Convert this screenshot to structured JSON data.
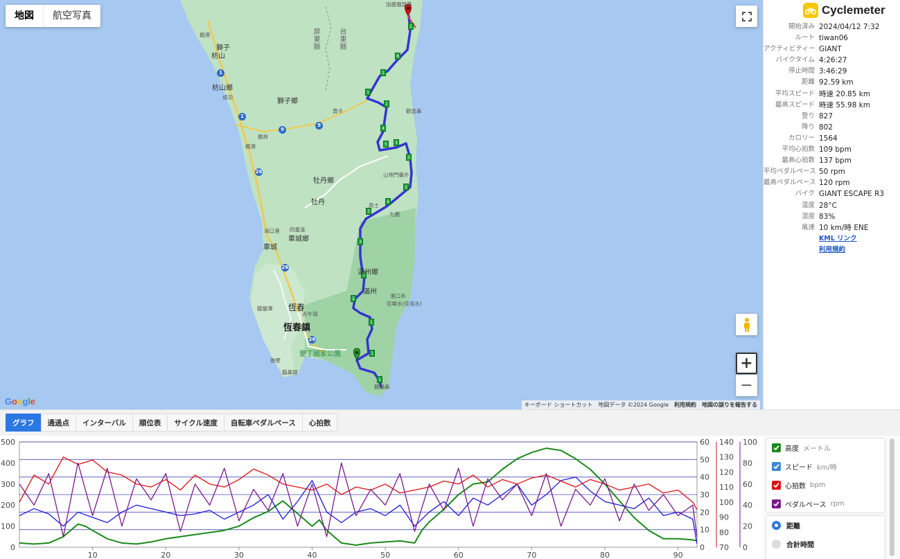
{
  "map_toggle": {
    "map": "地図",
    "satellite": "航空写真"
  },
  "map_labels": {
    "top": "加鹿俄部落",
    "county_pingtung": "屏東縣",
    "county_taitung": "台東縣",
    "fengang": "楓港",
    "shizi": "獅子",
    "fangshan": "枋山",
    "fangshan_xiang": "枋山鄉",
    "chenggong": "成功",
    "shizi_xiang": "獅子鄉",
    "shoka": "壽卡",
    "guanyinbi": "觀音鼻",
    "fengang2": "楓林",
    "fenggang3": "楓港",
    "mudan_xiang": "牡丹鄉",
    "mudan": "牡丹",
    "xuhai": "山地門番外",
    "gaoshi": "高士",
    "jiupeng": "九棚",
    "sichongxi": "四重溪",
    "checheng_xiang": "車城鄉",
    "haikou": "海口港",
    "checheng": "車城",
    "manzhou_xiang": "滿州鄉",
    "manzhou": "滿州",
    "gangkou": "港口吊",
    "jialeshui": "佳樂水(佳洛水)",
    "hengchun": "恆春",
    "hengchun_zhen": "恆春鎮",
    "longluan": "龍鑾潭",
    "dazhou": "赤牛嶺",
    "kenting": "墾丁國家公園",
    "eluanbi": "鵝鑾鼻",
    "houbi": "後壁",
    "maobitou": "貓鼻頭",
    "shanhai": "社頂"
  },
  "map_attribution": {
    "shortcuts": "キーボード ショートカット",
    "data": "地図データ ©2024 Google",
    "terms": "利用規約",
    "report": "地図の誤りを報告する"
  },
  "google_logo": "Google",
  "brand": {
    "name": "Cyclemeter"
  },
  "info": [
    {
      "k": "開始済み",
      "v": "2024/04/12 7:32"
    },
    {
      "k": "ルート",
      "v": "tiwan06"
    },
    {
      "k": "アクティビティー",
      "v": "GIANT"
    },
    {
      "k": "バイクタイム",
      "v": "4:26:27"
    },
    {
      "k": "停止時間",
      "v": "3:46:29"
    },
    {
      "k": "距離",
      "v": "92.59 km"
    },
    {
      "k": "平均スピード",
      "v": "時速 20.85 km"
    },
    {
      "k": "最高スピード",
      "v": "時速 55.98 km"
    },
    {
      "k": "登り",
      "v": "827"
    },
    {
      "k": "降り",
      "v": "802"
    },
    {
      "k": "カロリー",
      "v": "1564"
    },
    {
      "k": "平均心拍数",
      "v": "109 bpm"
    },
    {
      "k": "最高心拍数",
      "v": "137 bpm"
    },
    {
      "k": "平均ペダルペース",
      "v": "50 rpm"
    },
    {
      "k": "最高ペダルペース",
      "v": "120 rpm"
    },
    {
      "k": "バイク",
      "v": "GIANT ESCAPE R3"
    },
    {
      "k": "温度",
      "v": "28°C"
    },
    {
      "k": "湿度",
      "v": "83%"
    },
    {
      "k": "風速",
      "v": "10 km/時 ENE"
    }
  ],
  "links": {
    "kml": "KML リンク",
    "terms": "利用規約"
  },
  "tabs": [
    "グラフ",
    "通過点",
    "インターバル",
    "順位表",
    "サイクル速度",
    "自転車ペダルペース",
    "心拍数"
  ],
  "legend": [
    {
      "name": "高度",
      "unit": "メートル",
      "color": "#1a8a1a"
    },
    {
      "name": "スピード",
      "unit": "km/時",
      "color": "#3a8ad8"
    },
    {
      "name": "心拍数",
      "unit": "bpm",
      "color": "#e01010"
    },
    {
      "name": "ペダルペース",
      "unit": "rpm",
      "color": "#7a1a8a"
    }
  ],
  "x_axis_options": {
    "distance": "距離",
    "total_time": "合計時間"
  },
  "chart_data": {
    "type": "line",
    "xlabel": "",
    "xlim": [
      0,
      92.59
    ],
    "x_ticks": [
      10,
      20,
      30,
      40,
      50,
      60,
      70,
      80,
      90
    ],
    "axes": {
      "altitude": {
        "ticks": [
          0,
          100,
          200,
          300,
          400,
          500
        ],
        "range": [
          0,
          500
        ]
      },
      "speed": {
        "ticks": [
          0,
          10,
          20,
          30,
          40,
          50,
          60
        ],
        "range": [
          0,
          60
        ]
      },
      "heart_rate": {
        "ticks": [
          70,
          80,
          90,
          100,
          110,
          120,
          130,
          140
        ],
        "range": [
          70,
          140
        ]
      },
      "cadence": {
        "ticks": [
          0,
          20,
          40,
          60,
          80,
          100
        ],
        "range": [
          0,
          100
        ]
      }
    },
    "series": [
      {
        "name": "高度",
        "axis": "altitude",
        "color": "#1a8a1a",
        "x": [
          0,
          2,
          4,
          6,
          8,
          9,
          10,
          12,
          14,
          16,
          18,
          20,
          22,
          24,
          26,
          28,
          30,
          32,
          34,
          36,
          38,
          40,
          41,
          42,
          44,
          46,
          48,
          50,
          52,
          54,
          55,
          56,
          58,
          60,
          62,
          64,
          66,
          68,
          70,
          72,
          74,
          76,
          78,
          80,
          82,
          84,
          86,
          88,
          90,
          92,
          92.59
        ],
        "values": [
          20,
          15,
          20,
          50,
          110,
          100,
          80,
          40,
          20,
          15,
          25,
          40,
          50,
          60,
          70,
          80,
          100,
          140,
          170,
          220,
          160,
          100,
          130,
          80,
          20,
          10,
          20,
          25,
          30,
          20,
          80,
          120,
          180,
          250,
          300,
          310,
          370,
          420,
          450,
          470,
          460,
          420,
          370,
          300,
          220,
          140,
          80,
          40,
          40,
          35,
          30
        ]
      },
      {
        "name": "スピード",
        "axis": "speed",
        "color": "#1a1ad8",
        "x": [
          0,
          2,
          4,
          6,
          8,
          10,
          12,
          14,
          16,
          18,
          20,
          22,
          24,
          26,
          28,
          30,
          32,
          34,
          36,
          38,
          40,
          42,
          44,
          46,
          48,
          50,
          52,
          54,
          56,
          58,
          60,
          62,
          64,
          66,
          68,
          70,
          72,
          74,
          76,
          78,
          80,
          82,
          84,
          86,
          88,
          90,
          92,
          92.59
        ],
        "values": [
          18,
          22,
          19,
          12,
          20,
          17,
          14,
          20,
          24,
          22,
          20,
          18,
          19,
          21,
          16,
          20,
          24,
          30,
          16,
          26,
          38,
          20,
          14,
          20,
          22,
          18,
          24,
          12,
          20,
          26,
          18,
          28,
          24,
          30,
          36,
          24,
          30,
          38,
          40,
          32,
          26,
          24,
          22,
          28,
          18,
          20,
          16,
          2
        ]
      },
      {
        "name": "心拍数",
        "axis": "heart_rate",
        "color": "#e01010",
        "x": [
          0,
          2,
          4,
          6,
          8,
          10,
          12,
          14,
          16,
          18,
          20,
          22,
          24,
          26,
          28,
          30,
          32,
          34,
          36,
          38,
          40,
          42,
          44,
          46,
          48,
          50,
          52,
          54,
          56,
          58,
          60,
          62,
          64,
          66,
          68,
          70,
          72,
          74,
          76,
          78,
          80,
          82,
          84,
          86,
          88,
          90,
          92,
          92.59
        ],
        "values": [
          100,
          118,
          112,
          130,
          125,
          128,
          120,
          118,
          112,
          110,
          115,
          108,
          118,
          112,
          110,
          115,
          122,
          118,
          112,
          110,
          108,
          112,
          105,
          110,
          108,
          112,
          106,
          108,
          110,
          114,
          112,
          118,
          110,
          115,
          112,
          116,
          118,
          114,
          110,
          115,
          112,
          108,
          110,
          112,
          106,
          108,
          100,
          95
        ]
      },
      {
        "name": "ペダルペース",
        "axis": "cadence",
        "color": "#7a1a8a",
        "x": [
          0,
          2,
          4,
          6,
          8,
          10,
          12,
          14,
          16,
          18,
          20,
          22,
          24,
          26,
          28,
          30,
          32,
          34,
          36,
          38,
          40,
          42,
          44,
          46,
          48,
          50,
          52,
          54,
          56,
          58,
          60,
          62,
          64,
          66,
          68,
          70,
          72,
          74,
          76,
          78,
          80,
          82,
          84,
          86,
          88,
          90,
          92,
          92.59
        ],
        "values": [
          60,
          40,
          70,
          10,
          80,
          30,
          75,
          20,
          65,
          45,
          70,
          15,
          60,
          40,
          75,
          25,
          55,
          35,
          70,
          20,
          60,
          10,
          80,
          30,
          55,
          40,
          70,
          15,
          60,
          35,
          75,
          20,
          65,
          45,
          60,
          30,
          70,
          20,
          55,
          40,
          65,
          25,
          60,
          35,
          50,
          30,
          40,
          10
        ]
      }
    ]
  }
}
